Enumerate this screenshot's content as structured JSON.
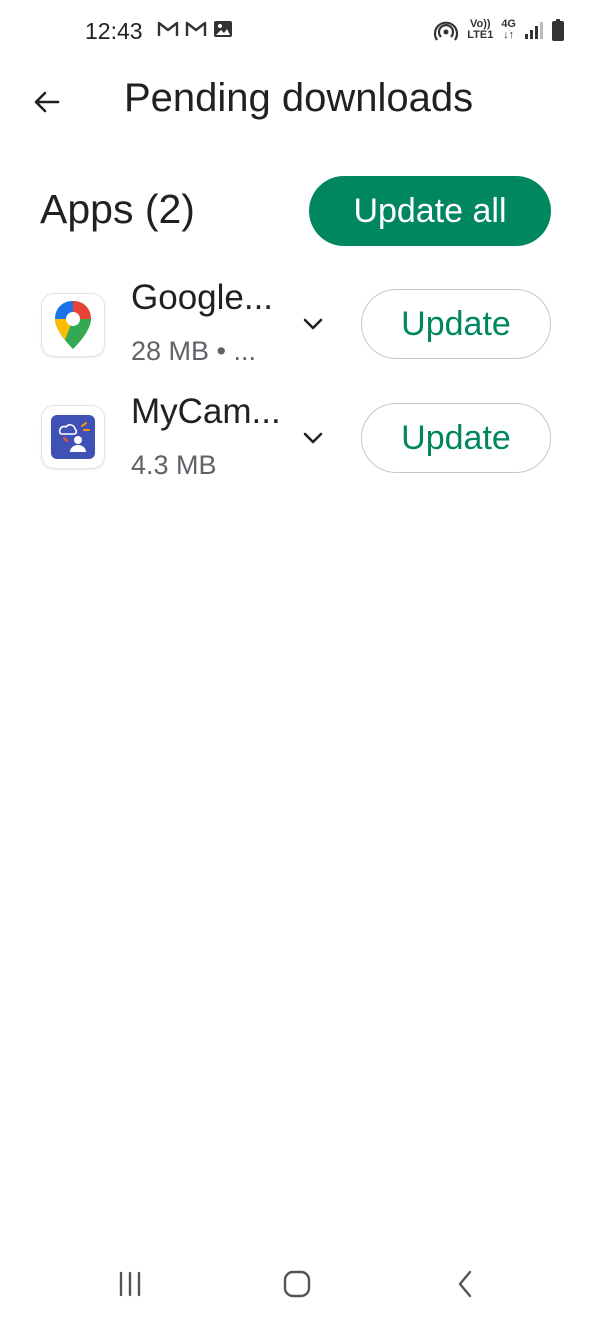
{
  "status_bar": {
    "time": "12:43",
    "left_icons": [
      "gmail-icon",
      "gmail-icon",
      "image-icon"
    ],
    "network_volte": "Vo))",
    "network_lte": "LTE1",
    "network_4g": "4G"
  },
  "header": {
    "title": "Pending downloads"
  },
  "section": {
    "title": "Apps (2)",
    "update_all_label": "Update all"
  },
  "apps": [
    {
      "name": "Google...",
      "meta": "28 MB  • ...",
      "icon": "google-maps-icon",
      "update_label": "Update"
    },
    {
      "name": "MyCam...",
      "meta": "4.3 MB",
      "icon": "mycam-icon",
      "update_label": "Update"
    }
  ],
  "colors": {
    "accent": "#01875f",
    "text_primary": "#202124",
    "text_secondary": "#5f6368"
  },
  "nav": {
    "buttons": [
      "recent-apps-icon",
      "home-icon",
      "back-icon"
    ]
  }
}
